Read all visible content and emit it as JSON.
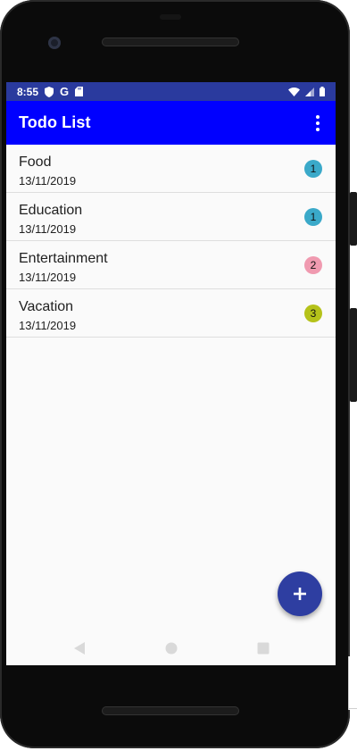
{
  "status_bar": {
    "time": "8:55",
    "google_glyph": "G",
    "icons": [
      "shield-icon",
      "google-icon",
      "sd-card-icon",
      "wifi-icon",
      "cell-signal-icon",
      "battery-icon"
    ]
  },
  "app_bar": {
    "title": "Todo List",
    "menu_icon": "more-vert-icon"
  },
  "todos": [
    {
      "title": "Food",
      "date": "13/11/2019",
      "count": "1",
      "badge_color": "#3aa9c9"
    },
    {
      "title": "Education",
      "date": "13/11/2019",
      "count": "1",
      "badge_color": "#3aa9c9"
    },
    {
      "title": "Entertainment",
      "date": "13/11/2019",
      "count": "2",
      "badge_color": "#f09ab0"
    },
    {
      "title": "Vacation",
      "date": "13/11/2019",
      "count": "3",
      "badge_color": "#b5c21a"
    }
  ],
  "fab": {
    "icon": "plus-icon",
    "color": "#2e3ea1"
  },
  "nav_bar": {
    "icons": [
      "back-icon",
      "home-icon",
      "recents-icon"
    ]
  },
  "colors": {
    "status_bar": "#2a3a9e",
    "app_bar": "#0000ff",
    "background": "#fafafa"
  }
}
